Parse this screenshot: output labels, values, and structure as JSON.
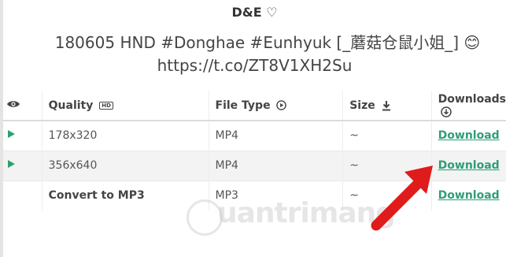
{
  "header": {
    "account": "D&E ♡",
    "tweet_line1": "180605 HND #Donghae #Eunhyuk [_蘑菇仓鼠小姐_] 😊",
    "tweet_line2": "https://t.co/ZT8V1XH2Su"
  },
  "table": {
    "headers": {
      "quality": "Quality",
      "quality_badge": "HD",
      "file_type": "File Type",
      "size": "Size",
      "downloads": "Downloads"
    },
    "rows": [
      {
        "quality": "178x320",
        "file_type": "MP4",
        "size": "~",
        "download": "Download"
      },
      {
        "quality": "356x640",
        "file_type": "MP4",
        "size": "~",
        "download": "Download"
      },
      {
        "quality": "Convert to MP3",
        "file_type": "MP3",
        "size": "~",
        "download": "Download"
      }
    ]
  },
  "watermark": "uantrimang",
  "colors": {
    "link": "#2e9e76",
    "play": "#2ea06e",
    "arrow": "#e01b1b",
    "stripe": "#f3f3f3"
  },
  "icons": {
    "eye": "eye-icon",
    "hd": "hd-badge-icon",
    "file_type": "play-circle-icon",
    "size": "download-arrow-icon",
    "downloads": "download-circle-icon",
    "row_play": "play-triangle-icon"
  }
}
